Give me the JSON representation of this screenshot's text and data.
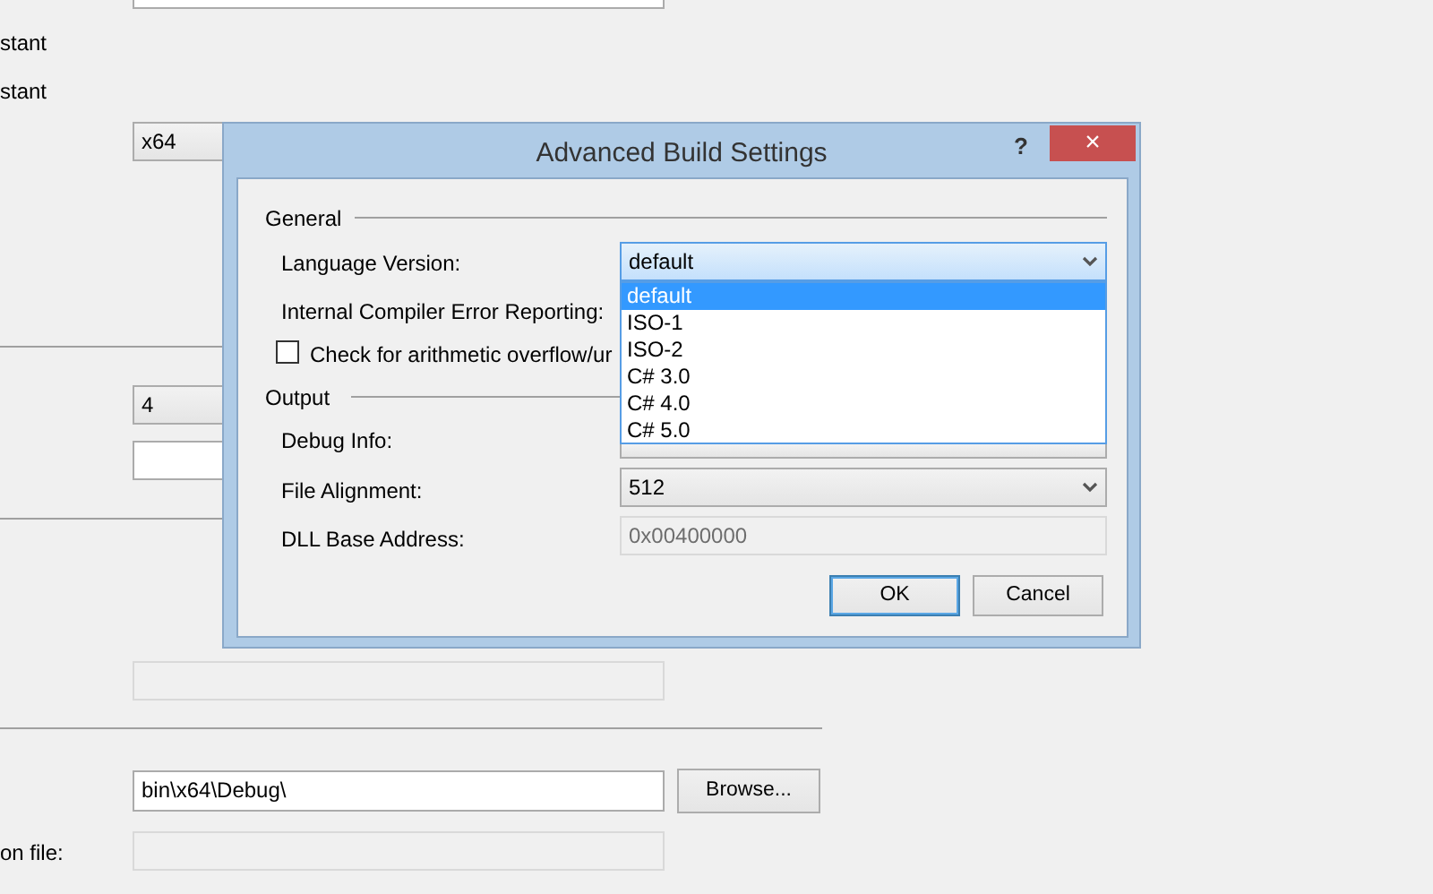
{
  "background": {
    "labels": [
      {
        "text": "stant"
      },
      {
        "text": "stant"
      },
      {
        "text": "on file:"
      }
    ],
    "platform_select": {
      "value": "x64"
    },
    "number_select": {
      "value": "4"
    },
    "output_path": {
      "value": "bin\\x64\\Debug\\"
    },
    "browse_button": "Browse..."
  },
  "dialog": {
    "title": "Advanced Build Settings",
    "help": "?",
    "close": "×",
    "general": {
      "heading": "General",
      "language_label": "Language Version:",
      "language_value": "default",
      "error_label": "Internal Compiler Error Reporting:",
      "overflow": {
        "label": "Check for arithmetic overflow/ur",
        "checked": false
      }
    },
    "language_options": [
      {
        "label": "default",
        "selected": true
      },
      {
        "label": "ISO-1",
        "selected": false
      },
      {
        "label": "ISO-2",
        "selected": false
      },
      {
        "label": "C# 3.0",
        "selected": false
      },
      {
        "label": "C# 4.0",
        "selected": false
      },
      {
        "label": "C# 5.0",
        "selected": false
      }
    ],
    "output": {
      "heading": "Output",
      "debug_label": "Debug Info:",
      "alignment_label": "File Alignment:",
      "alignment_value": "512",
      "base_label": "DLL Base Address:",
      "base_value": "0x00400000"
    },
    "buttons": [
      {
        "label": "OK",
        "default": true
      },
      {
        "label": "Cancel",
        "default": false
      }
    ]
  }
}
